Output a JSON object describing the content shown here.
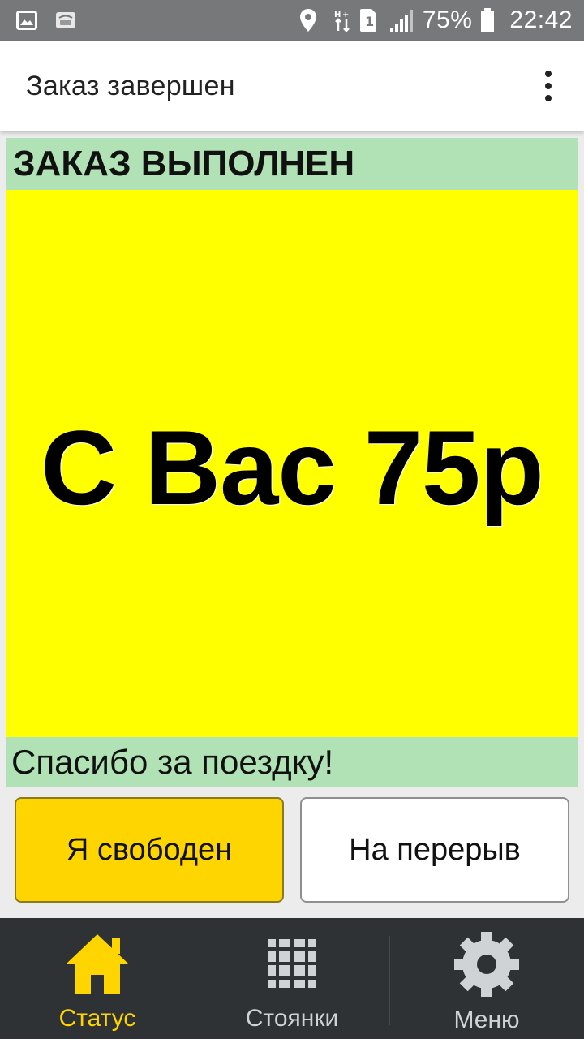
{
  "status_bar": {
    "battery_percent": "75%",
    "time": "22:42",
    "sim_slot": "1",
    "icons": [
      "gallery-icon",
      "notification-icon",
      "location-icon",
      "data-transfer-icon",
      "sim-icon",
      "signal-icon",
      "battery-icon"
    ]
  },
  "app_bar": {
    "title": "Заказ завершен",
    "overflow_icon": "more-vert-icon"
  },
  "order": {
    "status_title": "ЗАКАЗ ВЫПОЛНЕН",
    "price_text": "С Вас 75р",
    "thanks_text": "Спасибо за поездку!"
  },
  "actions": {
    "free_label": "Я свободен",
    "break_label": "На перерыв"
  },
  "bottom_nav": {
    "items": [
      {
        "label": "Статус",
        "icon": "home-icon",
        "active": true
      },
      {
        "label": "Стоянки",
        "icon": "grid-icon",
        "active": false
      },
      {
        "label": "Меню",
        "icon": "gear-icon",
        "active": false
      }
    ]
  },
  "colors": {
    "accent_yellow": "#ffd500",
    "price_background": "#ffff00",
    "header_green": "#b0e2b5",
    "nav_background": "#2f3234"
  }
}
